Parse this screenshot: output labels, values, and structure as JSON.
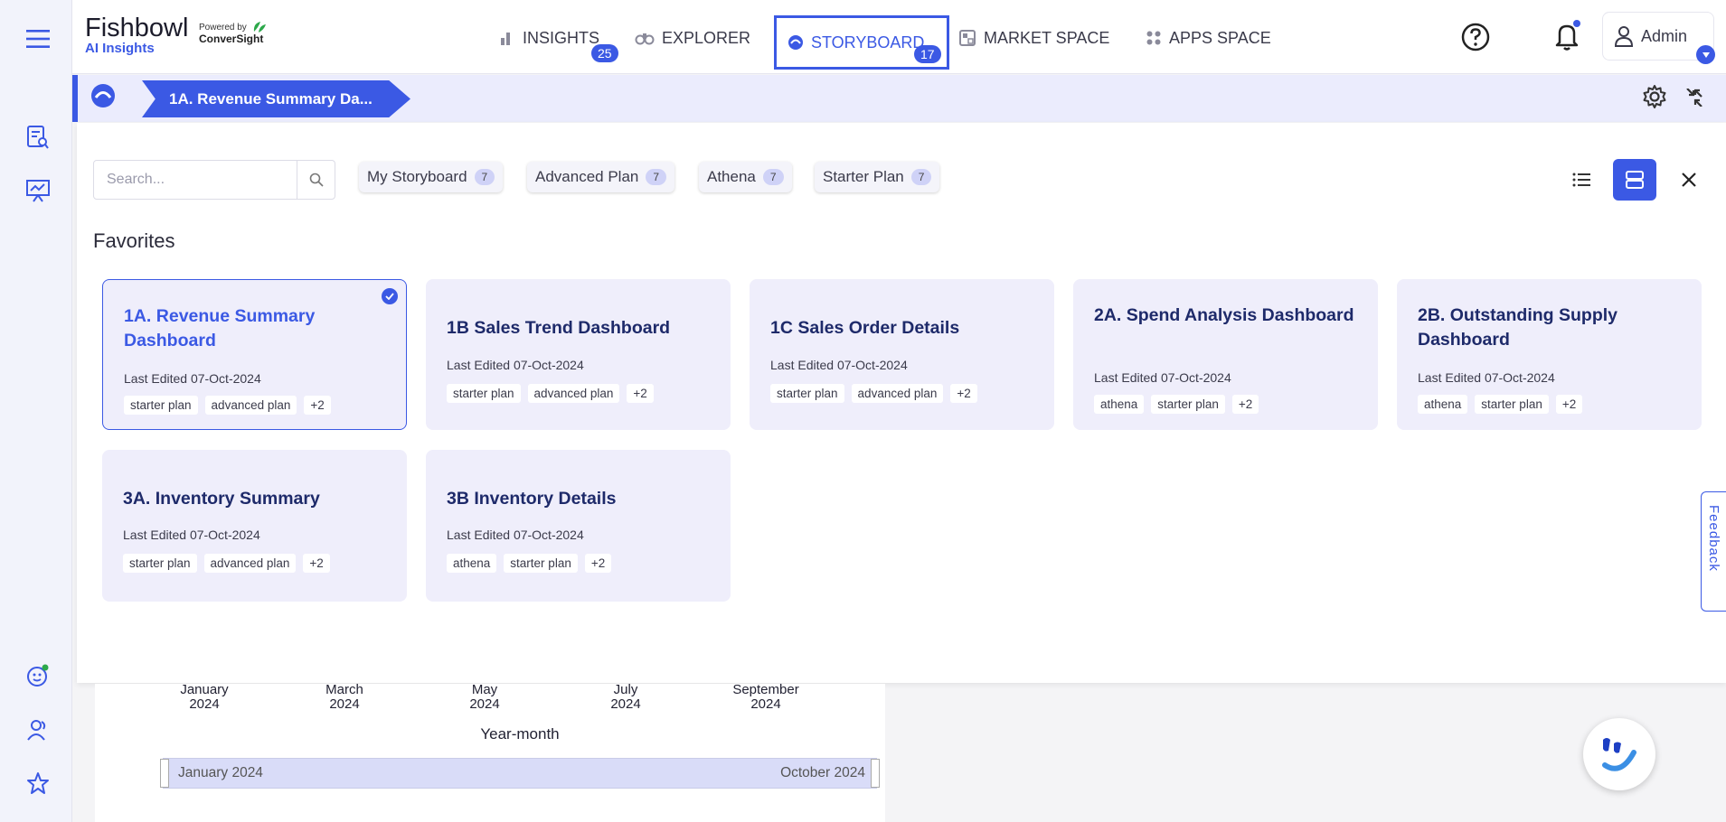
{
  "brand": {
    "name": "Fishbowl",
    "product": "AI Insights",
    "powered_by": "Powered by",
    "partner": "ConverSight"
  },
  "nav": {
    "insights": {
      "label": "INSIGHTS",
      "badge": "25"
    },
    "explorer": {
      "label": "EXPLORER"
    },
    "storyboard": {
      "label": "STORYBOARD",
      "badge": "17"
    },
    "market": {
      "label": "MARKET SPACE"
    },
    "apps": {
      "label": "APPS SPACE"
    },
    "user": "Admin"
  },
  "banner": {
    "breadcrumb": "1A. Revenue Summary Da..."
  },
  "panel": {
    "search_placeholder": "Search...",
    "chips": [
      {
        "label": "My Storyboard",
        "count": "7"
      },
      {
        "label": "Advanced Plan",
        "count": "7"
      },
      {
        "label": "Athena",
        "count": "7"
      },
      {
        "label": "Starter Plan",
        "count": "7"
      }
    ],
    "section_title": "Favorites",
    "cards": [
      {
        "title": "1A. Revenue Summary Dashboard",
        "edited": "Last Edited 07-Oct-2024",
        "tags": [
          "starter plan",
          "advanced plan",
          "+2"
        ],
        "selected": true
      },
      {
        "title": "1B Sales Trend Dashboard",
        "edited": "Last Edited 07-Oct-2024",
        "tags": [
          "starter plan",
          "advanced plan",
          "+2"
        ]
      },
      {
        "title": "1C Sales Order Details",
        "edited": "Last Edited 07-Oct-2024",
        "tags": [
          "starter plan",
          "advanced plan",
          "+2"
        ]
      },
      {
        "title": "2A. Spend Analysis Dashboard",
        "edited": "Last Edited 07-Oct-2024",
        "tags": [
          "athena",
          "starter plan",
          "+2"
        ]
      },
      {
        "title": "2B. Outstanding Supply Dashboard",
        "edited": "Last Edited 07-Oct-2024",
        "tags": [
          "athena",
          "starter plan",
          "+2"
        ]
      },
      {
        "title": "3A. Inventory Summary",
        "edited": "Last Edited 07-Oct-2024",
        "tags": [
          "starter plan",
          "advanced plan",
          "+2"
        ]
      },
      {
        "title": "3B Inventory Details",
        "edited": "Last Edited 07-Oct-2024",
        "tags": [
          "athena",
          "starter plan",
          "+2"
        ]
      }
    ]
  },
  "background_chart": {
    "ticks": [
      {
        "line1": "January",
        "line2": "2024"
      },
      {
        "line1": "March",
        "line2": "2024"
      },
      {
        "line1": "May",
        "line2": "2024"
      },
      {
        "line1": "July",
        "line2": "2024"
      },
      {
        "line1": "September",
        "line2": "2024"
      }
    ],
    "axis_label": "Year-month",
    "range_start": "January 2024",
    "range_end": "October 2024"
  },
  "feedback": "Feedback",
  "colors": {
    "accent": "#3b59e4",
    "card_bg": "#efeefb",
    "banner_bg": "#ebecfd"
  }
}
